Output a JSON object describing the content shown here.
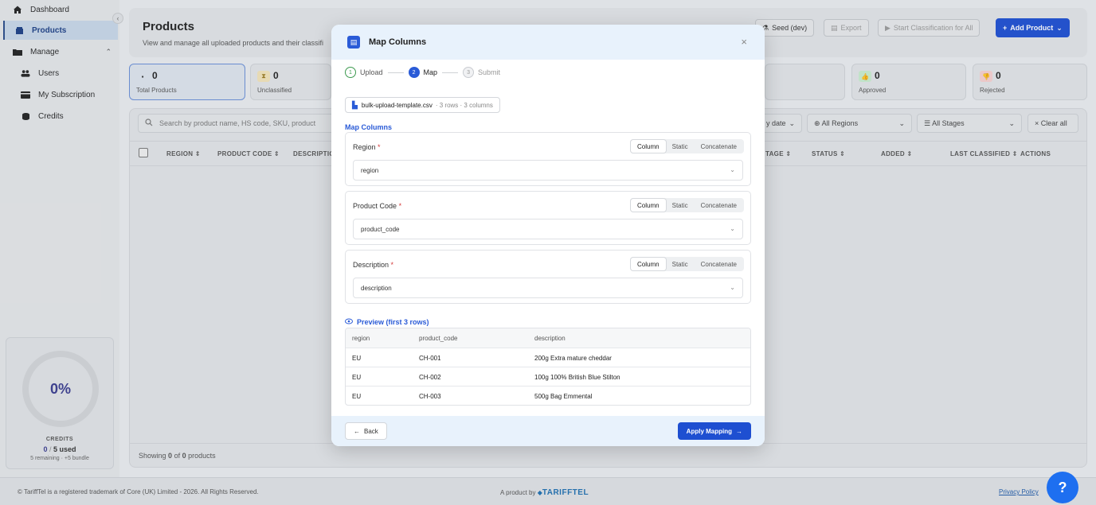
{
  "sidebar": {
    "items": [
      {
        "label": "Dashboard",
        "icon": "home-icon"
      },
      {
        "label": "Products",
        "icon": "box-icon"
      },
      {
        "label": "Manage",
        "icon": "folder-icon"
      },
      {
        "label": "Users",
        "icon": "users-icon"
      },
      {
        "label": "My Subscription",
        "icon": "card-icon"
      },
      {
        "label": "Credits",
        "icon": "coins-icon"
      }
    ],
    "credits": {
      "percent": "0%",
      "label": "CREDITS",
      "used": "0",
      "sep": "/",
      "total": "5 used",
      "remaining": "5 remaining · +5 bundle"
    }
  },
  "header": {
    "title": "Products",
    "subtitle": "View and manage all uploaded products and their classifi",
    "buttons": {
      "seed": "Seed (dev)",
      "export": "Export",
      "start": "Start Classification for All",
      "add": "Add Product"
    }
  },
  "stats": [
    {
      "value": "0",
      "label": "Total Products"
    },
    {
      "value": "0",
      "label": "Unclassified"
    },
    {
      "value": "0",
      "label": "Approved"
    },
    {
      "value": "0",
      "label": "Rejected"
    }
  ],
  "table": {
    "search_placeholder": "Search by product name, HS code, SKU, product",
    "filters": {
      "date": "y date",
      "regions": "All Regions",
      "stages": "All Stages",
      "clear": "Clear all"
    },
    "columns": [
      "REGION",
      "PRODUCT CODE",
      "DESCRIPTIO",
      "TAGE",
      "STATUS",
      "ADDED",
      "LAST CLASSIFIED",
      "ACTIONS"
    ],
    "footer": {
      "prefix": "Showing",
      "shown": "0",
      "of": "of",
      "total": "0",
      "suffix": "products"
    }
  },
  "modal": {
    "title": "Map Columns",
    "close": "×",
    "steps": [
      {
        "num": "1",
        "label": "Upload"
      },
      {
        "num": "2",
        "label": "Map"
      },
      {
        "num": "3",
        "label": "Submit"
      }
    ],
    "file": {
      "name": "bulk-upload-template.csv",
      "meta": "· 3 rows · 3 columns"
    },
    "section_title": "Map Columns",
    "mode_options": [
      "Column",
      "Static",
      "Concatenate"
    ],
    "mappings": [
      {
        "label": "Region",
        "required": "*",
        "value": "region"
      },
      {
        "label": "Product Code",
        "required": "*",
        "value": "product_code"
      },
      {
        "label": "Description",
        "required": "*",
        "value": "description"
      }
    ],
    "preview_title": "Preview (first 3 rows)",
    "preview": {
      "headers": [
        "region",
        "product_code",
        "description"
      ],
      "rows": [
        [
          "EU",
          "CH-001",
          "200g Extra mature cheddar"
        ],
        [
          "EU",
          "CH-002",
          "100g 100% British Blue Stilton"
        ],
        [
          "EU",
          "CH-003",
          "500g Bag Emmental"
        ]
      ]
    },
    "back_label": "Back",
    "apply_label": "Apply Mapping"
  },
  "footer": {
    "left": "© TariffTel is a registered trademark of Core (UK) Limited - 2026. All Rights Reserved.",
    "center": "A product by",
    "brand": "TARIFFTEL",
    "right": "Privacy Policy"
  },
  "help": "?"
}
